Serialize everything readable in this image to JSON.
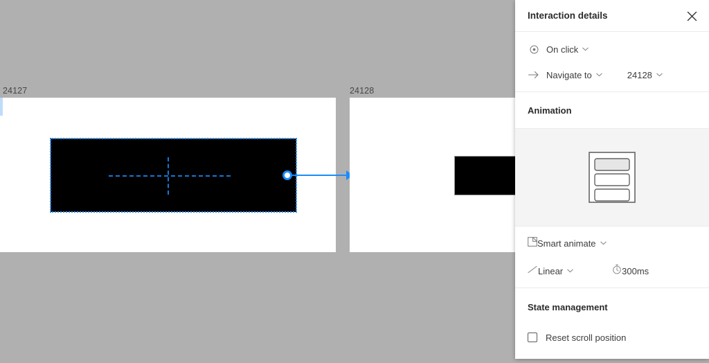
{
  "canvas": {
    "background_color": "#b0b0b0",
    "frames": [
      {
        "label": "24127",
        "shape_fill": "#000000",
        "selected": true
      },
      {
        "label": "24128",
        "shape_fill": "#000000",
        "selected": false
      }
    ],
    "connector": {
      "color": "#1a8cff",
      "from_frame": "24127",
      "to_frame": "24128"
    }
  },
  "panel": {
    "title": "Interaction details",
    "close_icon": "close-icon",
    "trigger": {
      "icon": "target-icon",
      "label": "On click",
      "chevron": "chevron-down-icon"
    },
    "action": {
      "icon": "arrow-right-icon",
      "label": "Navigate to",
      "chevron": "chevron-down-icon",
      "destination": "24128",
      "destination_chevron": "chevron-down-icon"
    },
    "animation": {
      "section_title": "Animation",
      "preview_icon": "animation-preview-frame-icon",
      "transition": {
        "icon": "smart-animate-icon",
        "label": "Smart animate",
        "chevron": "chevron-down-icon"
      },
      "easing": {
        "icon": "linear-curve-icon",
        "label": "Linear",
        "chevron": "chevron-down-icon"
      },
      "duration": {
        "icon": "stopwatch-icon",
        "value": "300ms"
      }
    },
    "state_management": {
      "section_title": "State management",
      "reset_scroll": {
        "label": "Reset scroll position",
        "checked": false
      }
    }
  }
}
